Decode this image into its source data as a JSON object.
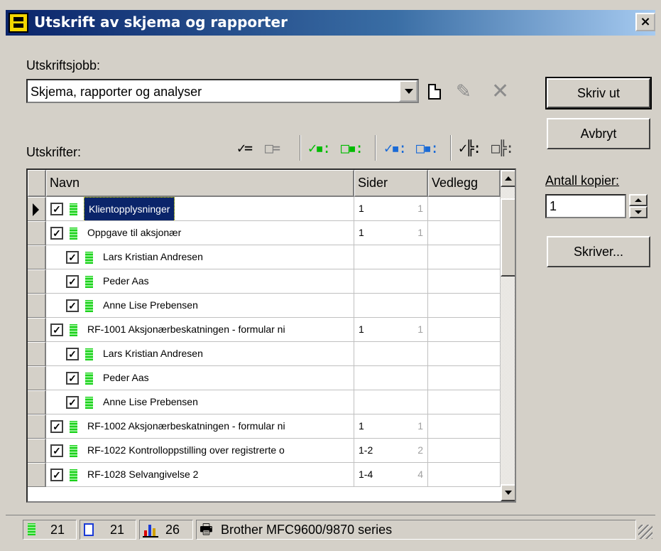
{
  "window": {
    "title": "Utskrift av skjema og rapporter",
    "close_label": "×"
  },
  "job": {
    "label": "Utskriftsjobb:",
    "selected": "Skjema, rapporter og analyser"
  },
  "buttons": {
    "print": "Skriv ut",
    "cancel": "Avbryt",
    "printer": "Skriver..."
  },
  "copies": {
    "label": "Antall kopier:",
    "value": "1"
  },
  "printouts_label": "Utskrifter:",
  "toolbar_icons": [
    "check-all-icon",
    "uncheck-all-icon",
    "check-green-icon",
    "uncheck-green-icon",
    "check-blue-icon",
    "uncheck-blue-icon",
    "check-mixed-icon",
    "uncheck-mixed-icon"
  ],
  "grid": {
    "columns": [
      "Navn",
      "Sider",
      "Vedlegg"
    ],
    "rows": [
      {
        "name": "Klientopplysninger",
        "pages": "1",
        "count": "1",
        "level": 0,
        "checked": true,
        "selected": true
      },
      {
        "name": "Oppgave til aksjonær",
        "pages": "1",
        "count": "1",
        "level": 0,
        "checked": true
      },
      {
        "name": "Lars Kristian Andresen",
        "pages": "",
        "count": "",
        "level": 1,
        "checked": true
      },
      {
        "name": "Peder Aas",
        "pages": "",
        "count": "",
        "level": 1,
        "checked": true
      },
      {
        "name": "Anne Lise Prebensen",
        "pages": "",
        "count": "",
        "level": 1,
        "checked": true
      },
      {
        "name": "RF-1001 Aksjonærbeskatningen - formular ni",
        "pages": "1",
        "count": "1",
        "level": 0,
        "checked": true
      },
      {
        "name": "Lars Kristian Andresen",
        "pages": "",
        "count": "",
        "level": 1,
        "checked": true
      },
      {
        "name": "Peder Aas",
        "pages": "",
        "count": "",
        "level": 1,
        "checked": true
      },
      {
        "name": "Anne Lise Prebensen",
        "pages": "",
        "count": "",
        "level": 1,
        "checked": true
      },
      {
        "name": "RF-1002 Aksjonærbeskatningen - formular ni",
        "pages": "1",
        "count": "1",
        "level": 0,
        "checked": true
      },
      {
        "name": "RF-1022 Kontrolloppstilling over registrerte o",
        "pages": "1-2",
        "count": "2",
        "level": 0,
        "checked": true
      },
      {
        "name": "RF-1028 Selvangivelse 2",
        "pages": "1-4",
        "count": "4",
        "level": 0,
        "checked": true
      }
    ]
  },
  "status": {
    "forms_count": "21",
    "reports_count": "21",
    "analyses_count": "26",
    "printer_name": "Brother MFC9600/9870 series"
  }
}
